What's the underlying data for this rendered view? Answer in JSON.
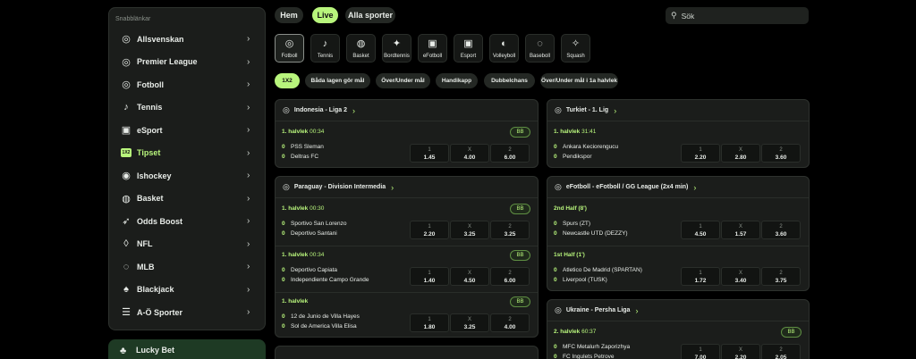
{
  "sidebar": {
    "section_title": "Snabblänkar",
    "items": [
      {
        "label": "Allsvenskan",
        "icon": "football-icon"
      },
      {
        "label": "Premier League",
        "icon": "football-icon"
      },
      {
        "label": "Fotboll",
        "icon": "football-icon"
      },
      {
        "label": "Tennis",
        "icon": "tennis-icon"
      },
      {
        "label": "eSport",
        "icon": "gamepad-icon"
      },
      {
        "label": "Tipset",
        "icon": "tipset-badge-icon",
        "badge": "1X2",
        "active": true
      },
      {
        "label": "Ishockey",
        "icon": "hockey-icon"
      },
      {
        "label": "Basket",
        "icon": "basketball-icon"
      },
      {
        "label": "Odds Boost",
        "icon": "rocket-icon"
      },
      {
        "label": "NFL",
        "icon": "american-football-icon"
      },
      {
        "label": "MLB",
        "icon": "baseball-icon"
      },
      {
        "label": "Blackjack",
        "icon": "spade-icon"
      },
      {
        "label": "A-Ö Sporter",
        "icon": "list-icon"
      }
    ],
    "lucky_bet": "Lucky Bet"
  },
  "nav": {
    "home": "Hem",
    "live": "Live",
    "all_sports": "Alla sporter",
    "search_placeholder": "Sök"
  },
  "sports": [
    {
      "label": "Fotboll",
      "icon": "football-icon",
      "active": true
    },
    {
      "label": "Tennis",
      "icon": "tennis-icon"
    },
    {
      "label": "Basket",
      "icon": "basketball-icon"
    },
    {
      "label": "Bordtennis",
      "icon": "table-tennis-icon"
    },
    {
      "label": "eFotboll",
      "icon": "gamepad-icon"
    },
    {
      "label": "Esport",
      "icon": "gamepad-icon"
    },
    {
      "label": "Volleyboll",
      "icon": "volleyball-icon"
    },
    {
      "label": "Baseboll",
      "icon": "baseball-icon"
    },
    {
      "label": "Squash",
      "icon": "squash-icon"
    }
  ],
  "markets": [
    "1X2",
    "Båda lagen gör mål",
    "Över/Under mål",
    "Handikapp",
    "Dubbelchans",
    "Över/Under mål i 1a halvlek"
  ],
  "colors": {
    "accent": "#b8f57c",
    "card_bg": "#1b1d1b",
    "page_bg": "#000000"
  },
  "left_column": [
    {
      "league": "Indonesia - Liga 2",
      "matches": [
        {
          "status": "1. halvlek",
          "time": "00:34",
          "bb": "BB",
          "home": "PSS Sleman",
          "away": "Deltras FC",
          "home_score": "0",
          "away_score": "0",
          "odds": [
            {
              "k": "1",
              "v": "1.45"
            },
            {
              "k": "X",
              "v": "4.00"
            },
            {
              "k": "2",
              "v": "6.00"
            }
          ]
        }
      ]
    },
    {
      "league": "Paraguay - Division Intermedia",
      "matches": [
        {
          "status": "1. halvlek",
          "time": "00:30",
          "bb": "BB",
          "home": "Sportivo San Lorenzo",
          "away": "Deportivo Santani",
          "home_score": "0",
          "away_score": "0",
          "odds": [
            {
              "k": "1",
              "v": "2.20"
            },
            {
              "k": "X",
              "v": "3.25"
            },
            {
              "k": "2",
              "v": "3.25"
            }
          ]
        },
        {
          "status": "1. halvlek",
          "time": "00:34",
          "bb": "BB",
          "home": "Deportivo Capiata",
          "away": "Independiente Campo Grande",
          "home_score": "0",
          "away_score": "0",
          "odds": [
            {
              "k": "1",
              "v": "1.40"
            },
            {
              "k": "X",
              "v": "4.50"
            },
            {
              "k": "2",
              "v": "6.00"
            }
          ]
        },
        {
          "status": "1. halvlek",
          "time": "",
          "bb": "BB",
          "home": "12 de Junio de Villa Hayes",
          "away": "Sol de America Villa Elisa",
          "home_score": "0",
          "away_score": "0",
          "odds": [
            {
              "k": "1",
              "v": "1.80"
            },
            {
              "k": "X",
              "v": "3.25"
            },
            {
              "k": "2",
              "v": "4.00"
            }
          ]
        }
      ]
    }
  ],
  "right_column": [
    {
      "league": "Turkiet - 1. Lig",
      "matches": [
        {
          "status": "1. halvlek",
          "time": "31:41",
          "home": "Ankara Keciorengucu",
          "away": "Pendikspor",
          "home_score": "0",
          "away_score": "0",
          "odds": [
            {
              "k": "1",
              "v": "2.20"
            },
            {
              "k": "X",
              "v": "2.80"
            },
            {
              "k": "2",
              "v": "3.60"
            }
          ]
        }
      ]
    },
    {
      "league": "eFotboll - eFotboll / GG League (2x4 min)",
      "matches": [
        {
          "status": "2nd Half (8')",
          "time": "",
          "home": "Spurs (ZT)",
          "away": "Newcastle UTD (DEZZY)",
          "home_score": "0",
          "away_score": "0",
          "odds": [
            {
              "k": "1",
              "v": "4.50"
            },
            {
              "k": "X",
              "v": "1.57"
            },
            {
              "k": "2",
              "v": "3.60"
            }
          ]
        },
        {
          "status": "1st Half (1')",
          "time": "",
          "home": "Atletico De Madrid (SPARTAN)",
          "away": "Liverpool (TUSK)",
          "home_score": "0",
          "away_score": "0",
          "odds": [
            {
              "k": "1",
              "v": "1.72"
            },
            {
              "k": "X",
              "v": "3.40"
            },
            {
              "k": "2",
              "v": "3.75"
            }
          ]
        }
      ]
    },
    {
      "league": "Ukraine - Persha Liga",
      "matches": [
        {
          "status": "2. halvlek",
          "time": "60:37",
          "bb": "BB",
          "home": "MFC Metalurh Zaporizhya",
          "away": "FC Ingulets Petrove",
          "home_score": "0",
          "away_score": "0",
          "odds": [
            {
              "k": "1",
              "v": "7.00"
            },
            {
              "k": "X",
              "v": "2.20"
            },
            {
              "k": "2",
              "v": "2.05"
            }
          ]
        }
      ]
    }
  ]
}
